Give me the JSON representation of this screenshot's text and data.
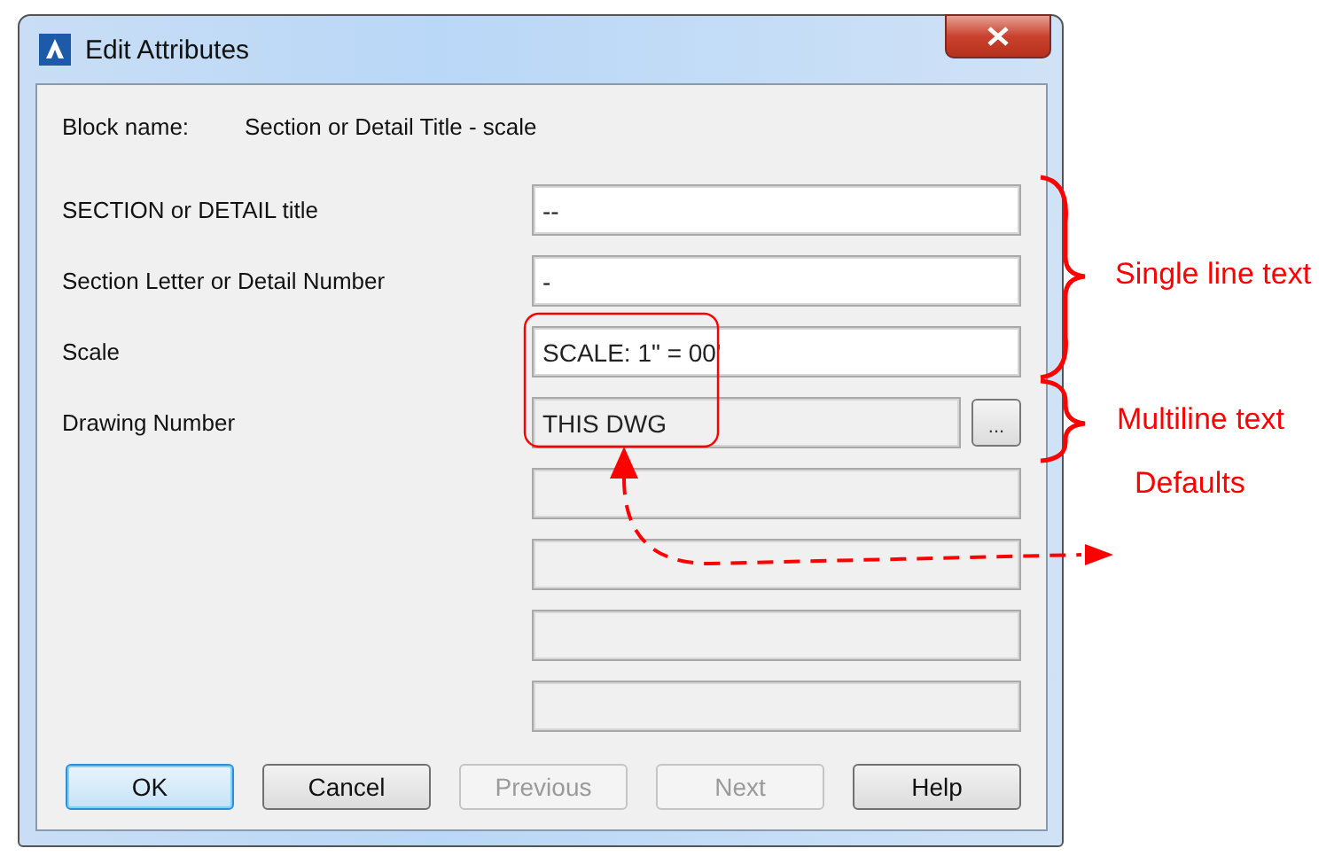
{
  "window": {
    "title": "Edit Attributes"
  },
  "block_name": {
    "label": "Block name:",
    "value": "Section or Detail Title - scale"
  },
  "attributes": [
    {
      "kind": "single",
      "label": "SECTION or DETAIL title",
      "value": "--",
      "disabled": false
    },
    {
      "kind": "single",
      "label": "Section Letter or Detail Number",
      "value": "-",
      "disabled": false
    },
    {
      "kind": "single",
      "label": "Scale",
      "value": "SCALE: 1\" = 00'",
      "disabled": false
    },
    {
      "kind": "multiline",
      "label": "Drawing Number",
      "value": "THIS DWG",
      "disabled": true,
      "button": "..."
    },
    {
      "kind": "blank",
      "disabled": true
    },
    {
      "kind": "blank",
      "disabled": true
    },
    {
      "kind": "blank",
      "disabled": true
    },
    {
      "kind": "blank",
      "disabled": true
    }
  ],
  "buttons": [
    {
      "label": "OK",
      "default": true,
      "disabled": false
    },
    {
      "label": "Cancel",
      "default": false,
      "disabled": false
    },
    {
      "label": "Previous",
      "default": false,
      "disabled": true
    },
    {
      "label": "Next",
      "default": false,
      "disabled": true
    },
    {
      "label": "Help",
      "default": false,
      "disabled": false
    }
  ],
  "annotations": {
    "braces": [
      {
        "label": "Single line text"
      },
      {
        "label": "Multiline text"
      }
    ],
    "note": "Defaults"
  }
}
